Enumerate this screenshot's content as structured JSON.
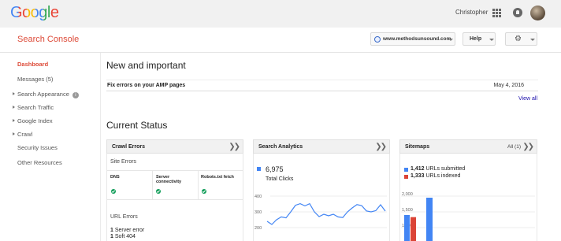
{
  "header": {
    "logo": "Google",
    "user_name": "Christopher",
    "icons": [
      "apps-grid-icon",
      "notifications-icon",
      "avatar"
    ]
  },
  "subheader": {
    "product": "Search Console",
    "site": "www.methodsunsound.com",
    "help_label": "Help",
    "settings_icon": "gear-icon"
  },
  "sidebar": {
    "items": [
      {
        "label": "Dashboard",
        "active": true
      },
      {
        "label": "Messages (5)"
      },
      {
        "label": "Search Appearance",
        "expandable": true,
        "info": true
      },
      {
        "label": "Search Traffic",
        "expandable": true
      },
      {
        "label": "Google Index",
        "expandable": true
      },
      {
        "label": "Crawl",
        "expandable": true
      },
      {
        "label": "Security Issues"
      },
      {
        "label": "Other Resources"
      }
    ]
  },
  "new_and_important": {
    "title": "New and important",
    "alert_title": "Fix errors on your AMP pages",
    "alert_date": "May 4, 2016",
    "view_all": "View all"
  },
  "current_status": {
    "title": "Current Status",
    "crawl_errors": {
      "title": "Crawl Errors",
      "site_errors_label": "Site Errors",
      "columns": [
        "DNS",
        "Server connectivity",
        "Robots.txt fetch"
      ],
      "url_errors_label": "URL Errors",
      "url_errors": [
        {
          "count": "1",
          "label": "Server error"
        },
        {
          "count": "1",
          "label": "Soft 404"
        }
      ]
    },
    "search_analytics": {
      "title": "Search Analytics",
      "total_clicks_value": "6,975",
      "total_clicks_label": "Total Clicks"
    },
    "sitemaps": {
      "title": "Sitemaps",
      "filter": "All (1)",
      "submitted_value": "1,412",
      "submitted_label": "URLs submitted",
      "indexed_value": "1,333",
      "indexed_label": "URLs indexed"
    }
  },
  "colors": {
    "brand_red": "#dd4b39",
    "series_blue": "#4285f4",
    "indexed_red": "#db4437",
    "ok_green": "#0f9d58",
    "link_blue": "#1a0dab"
  },
  "chart_data": [
    {
      "type": "line",
      "ylim": [
        200,
        400
      ],
      "yticks": [
        "400",
        "300",
        "200"
      ],
      "series": [
        {
          "values": [
            240,
            220,
            250,
            268,
            262,
            300,
            342,
            352,
            338,
            352,
            300,
            270,
            285,
            275,
            285,
            268,
            264,
            300,
            325,
            346,
            340,
            306,
            300,
            308,
            345,
            305
          ]
        }
      ]
    },
    {
      "type": "bar",
      "yticks": [
        "2,000",
        "1,500",
        "1,000"
      ],
      "series": [
        {
          "name": "URLs submitted",
          "values": [
            1400,
            1950
          ]
        },
        {
          "name": "URLs indexed",
          "values": [
            1333
          ]
        }
      ]
    }
  ]
}
